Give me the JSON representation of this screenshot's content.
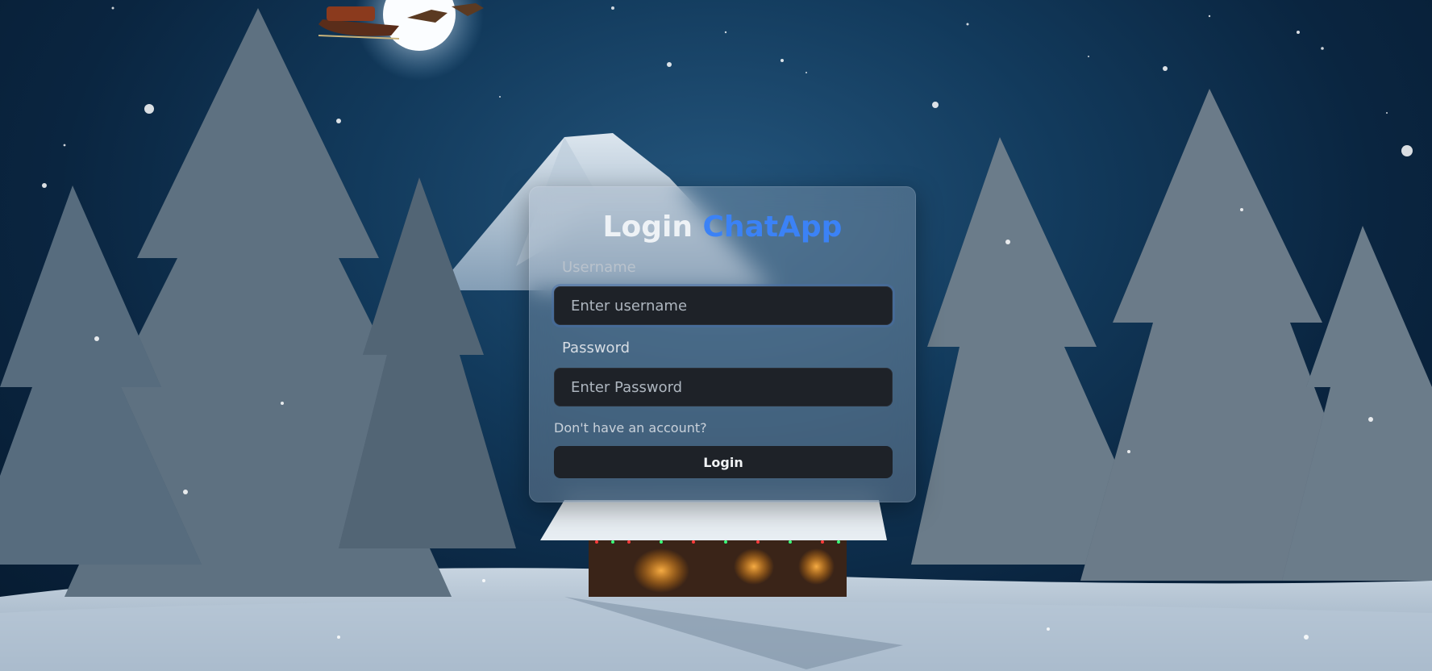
{
  "login": {
    "title_prefix": "Login",
    "title_brand": "ChatApp",
    "username_label": "Username",
    "username_placeholder": "Enter username",
    "username_value": "",
    "password_label": "Password",
    "password_placeholder": "Enter Password",
    "password_value": "",
    "signup_link": "Don't have an account?",
    "submit_label": "Login"
  },
  "colors": {
    "brand": "#3b82f6",
    "input_bg": "#1e2228",
    "button_bg": "#1e2228",
    "card_tint": "rgba(170,185,200,0.32)"
  },
  "background": {
    "scene": "winter-night-snowy-forest-with-moon-and-cabin",
    "icons": [
      "moon-icon",
      "santa-sleigh-icon",
      "cabin-icon",
      "pine-tree-icon",
      "mountain-icon"
    ]
  }
}
